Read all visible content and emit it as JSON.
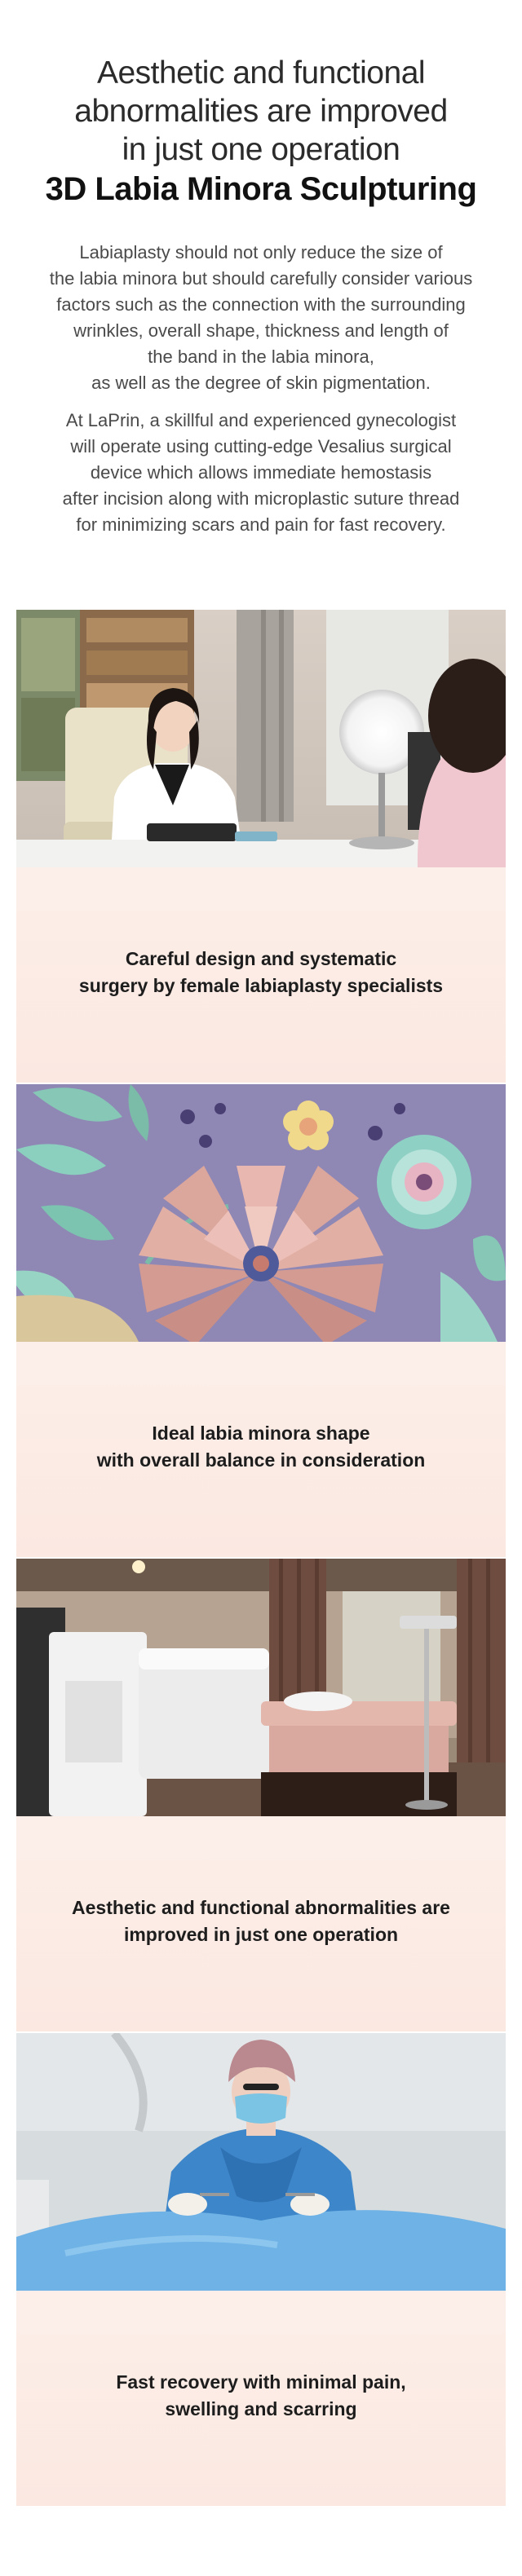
{
  "hero": {
    "line1": "Aesthetic and functional",
    "line2": "abnormalities are improved",
    "line3": "in just one operation",
    "heading": "3D Labia Minora Sculpturing"
  },
  "intro": {
    "paragraph1": [
      "Labiaplasty should not only reduce the size of",
      "the labia minora but should carefully consider various",
      "factors such as the connection with the surrounding",
      "wrinkles, overall shape, thickness and length of",
      "the band in the labia minora,",
      "as well as the degree of skin pigmentation."
    ],
    "paragraph2": [
      "At LaPrin, a skillful and experienced gynecologist",
      "will operate using cutting-edge Vesalius surgical",
      "device which allows immediate hemostasis",
      "after incision along with microplastic suture thread",
      "for minimizing scars and pain for fast recovery."
    ]
  },
  "cards": [
    {
      "caption": [
        "Careful design and systematic",
        "surgery by female labiaplasty specialists"
      ]
    },
    {
      "caption": [
        "Ideal labia minora shape",
        "with overall balance in consideration"
      ]
    },
    {
      "caption": [
        "Aesthetic and functional abnormalities are",
        "improved in just one operation"
      ]
    },
    {
      "caption": [
        "Fast recovery with minimal pain,",
        "swelling and scarring"
      ]
    }
  ],
  "colors": {
    "panel": "#fcefe9",
    "heading": "#111111",
    "body_text": "#4a4a4a"
  }
}
